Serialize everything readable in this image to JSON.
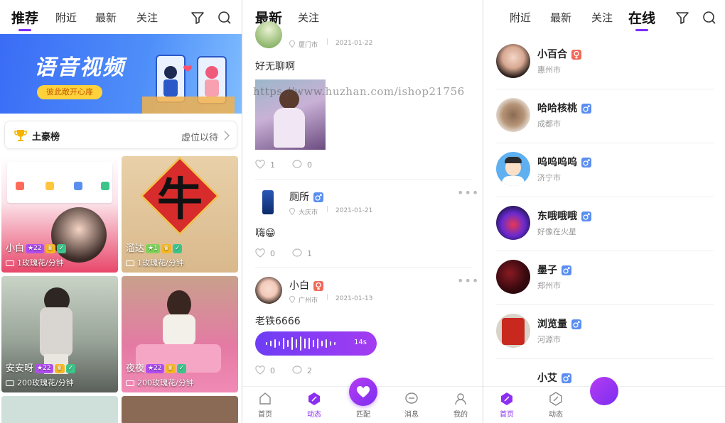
{
  "screen1": {
    "tabs": [
      "推荐",
      "附近",
      "最新",
      "关注"
    ],
    "banner": {
      "title": "语音视频",
      "button": "彼此敞开心扉"
    },
    "rank": {
      "title": "土豪榜",
      "right": "虚位以待"
    },
    "cards": [
      {
        "name": "小白",
        "price": "1玫瑰花/分钟",
        "level": "22"
      },
      {
        "name": "溜达",
        "price": "1玫瑰花/分钟",
        "level": "1"
      },
      {
        "name": "安安呀",
        "price": "200玫瑰花/分钟",
        "level": "22"
      },
      {
        "name": "夜夜",
        "price": "200玫瑰花/分钟",
        "level": "22"
      }
    ],
    "poster_char": "牛"
  },
  "screen2": {
    "tabs": [
      "最新",
      "关注"
    ],
    "posts": [
      {
        "name": "",
        "city": "厦门市",
        "date": "2021-01-22",
        "text": "好无聊啊",
        "likes": "1",
        "comments": "0"
      },
      {
        "name": "厕所",
        "city": "大庆市",
        "date": "2021-01-21",
        "text": "嗨😁",
        "likes": "0",
        "comments": "1"
      },
      {
        "name": "小白",
        "city": "广州市",
        "date": "2021-01-13",
        "text": "老铁6666",
        "voice_duration": "14s",
        "likes": "0",
        "comments": "2"
      }
    ],
    "bottom_nav": [
      "首页",
      "动态",
      "匹配",
      "消息",
      "我的"
    ]
  },
  "screen3": {
    "tabs": [
      "附近",
      "最新",
      "关注",
      "在线"
    ],
    "users": [
      {
        "name": "小百合",
        "city": "惠州市",
        "gender": "female"
      },
      {
        "name": "哈哈核桃",
        "city": "成都市",
        "gender": "male"
      },
      {
        "name": "呜呜呜呜",
        "city": "济宁市",
        "gender": "male"
      },
      {
        "name": "东哦哦哦",
        "city": "好像在火星",
        "gender": "male"
      },
      {
        "name": "墨子",
        "city": "郑州市",
        "gender": "male"
      },
      {
        "name": "浏览量",
        "city": "河源市",
        "gender": "male"
      },
      {
        "name": "小艾",
        "city": "",
        "gender": "male"
      }
    ],
    "bottom_nav": [
      "首页",
      "动态"
    ]
  },
  "watermark": "https://www.huzhan.com/ishop21756",
  "colors": {
    "accent": "#7b2bf9",
    "male": "#5b8ef0",
    "female": "#f06a5a"
  }
}
